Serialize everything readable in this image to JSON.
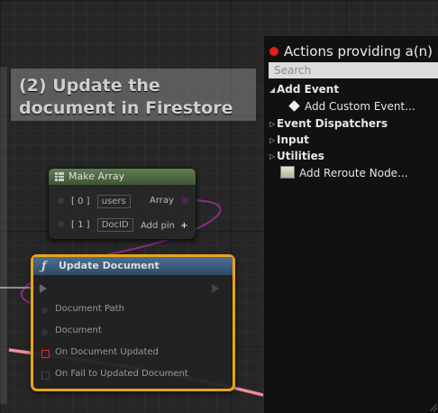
{
  "graph": {
    "comment_title": "(2) Update the document in Firestore"
  },
  "make_array": {
    "title": "Make Array",
    "pins": [
      {
        "index": "[ 0 ]",
        "value": "users"
      },
      {
        "index": "[ 1 ]",
        "value": "DocID"
      }
    ],
    "output_label": "Array",
    "add_pin_label": "Add pin",
    "add_pin_icon": "plus-icon"
  },
  "update_document": {
    "title": "Update Document",
    "pins": [
      "Document Path",
      "Document",
      "On Document Updated",
      "On Fail to Updated Document"
    ]
  },
  "action_menu": {
    "title": "Actions providing a(n) D",
    "search_placeholder": "Search",
    "items": [
      {
        "label": "Add Event",
        "type": "category-expanded"
      },
      {
        "label": "Add Custom Event...",
        "type": "action",
        "icon": "custom-event-icon"
      },
      {
        "label": "Event Dispatchers",
        "type": "category-collapsed"
      },
      {
        "label": "Input",
        "type": "category-collapsed"
      },
      {
        "label": "Utilities",
        "type": "category-collapsed"
      },
      {
        "label": "Add Reroute Node...",
        "type": "action",
        "icon": "reroute-node-icon"
      }
    ]
  },
  "colors": {
    "selection_outline": "#e8a317",
    "array_wire": "#8a2a8c",
    "delegate_wire": "#f08a9a",
    "context_menu_bg": "#111111",
    "close_dot": "#e41c1c"
  }
}
